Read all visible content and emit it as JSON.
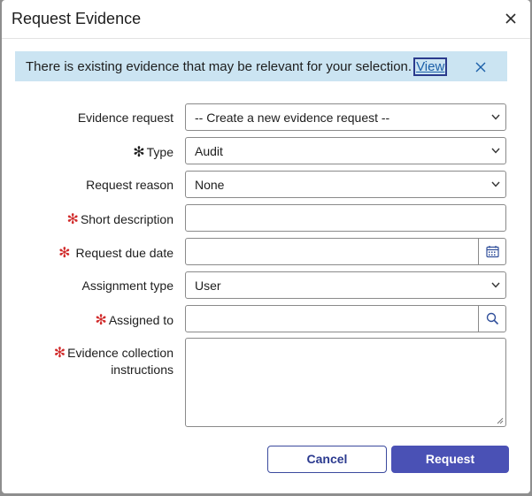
{
  "dialog": {
    "title": "Request Evidence",
    "close_icon": "close-icon"
  },
  "banner": {
    "text": "There is existing evidence that may be relevant for your selection.",
    "link": "View",
    "close_icon": "close-icon"
  },
  "form": {
    "evidence_request": {
      "label": "Evidence request",
      "value": "-- Create a new evidence request --"
    },
    "type": {
      "label": "Type",
      "required_marker": "✻",
      "value": "Audit"
    },
    "request_reason": {
      "label": "Request reason",
      "value": "None"
    },
    "short_description": {
      "label": "Short description",
      "required_marker": "✻",
      "value": ""
    },
    "request_due_date": {
      "label": "Request due date",
      "required_marker": "✻",
      "value": "",
      "icon": "calendar-icon"
    },
    "assignment_type": {
      "label": "Assignment type",
      "value": "User"
    },
    "assigned_to": {
      "label": "Assigned to",
      "required_marker": "✻",
      "value": "",
      "icon": "search-icon"
    },
    "instructions": {
      "label": "Evidence collection instructions",
      "required_marker": "✻",
      "value": ""
    }
  },
  "buttons": {
    "cancel": "Cancel",
    "request": "Request"
  },
  "colors": {
    "banner_bg": "#cbe4f2",
    "primary": "#4a51b5",
    "required": "#d12b2b"
  }
}
